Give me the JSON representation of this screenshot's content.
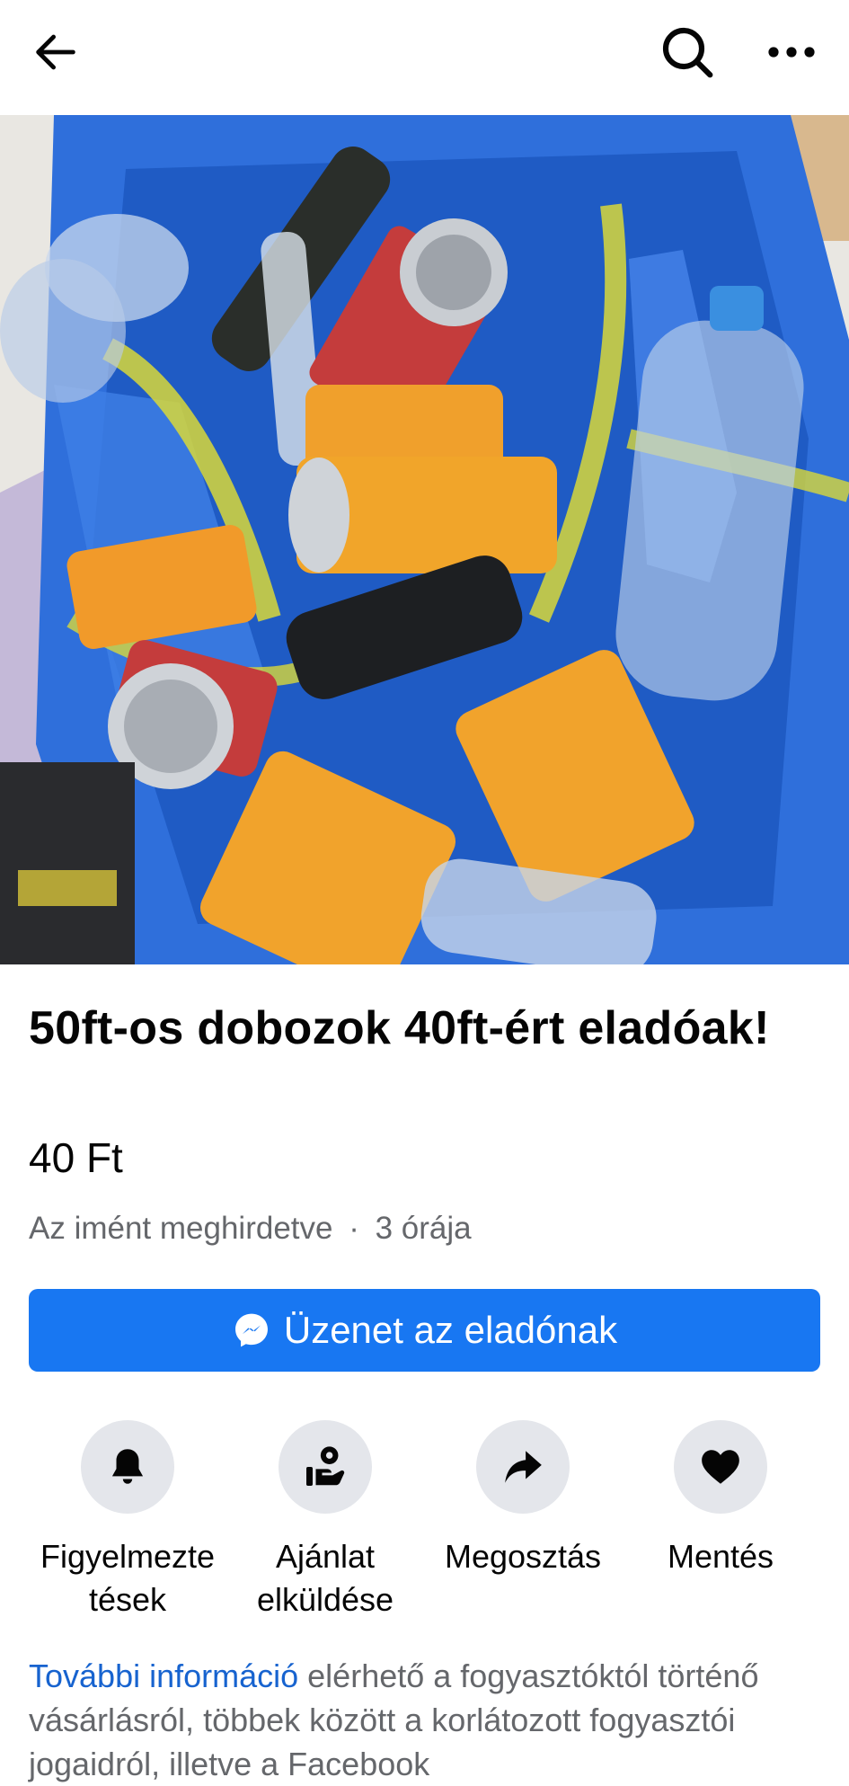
{
  "header": {
    "back_icon": "arrow-left-icon",
    "search_icon": "search-icon",
    "more_icon": "more-horizontal-icon"
  },
  "listing": {
    "title": "50ft-os dobozok 40ft-ért eladóak!",
    "price": "40 Ft",
    "posted": "Az imént meghirdetve",
    "separator": "·",
    "age": "3 órája"
  },
  "cta": {
    "icon": "messenger-icon",
    "label": "Üzenet az eladónak",
    "color": "#1877f2"
  },
  "actions": [
    {
      "icon": "bell-icon",
      "label_line1": "Figyelmezte",
      "label_line2": "tések"
    },
    {
      "icon": "offer-hand-icon",
      "label_line1": "Ajánlat",
      "label_line2": "elküldése"
    },
    {
      "icon": "share-icon",
      "label_line1": "Megosztás",
      "label_line2": ""
    },
    {
      "icon": "heart-icon",
      "label_line1": "Mentés",
      "label_line2": ""
    }
  ],
  "info": {
    "link": "További információ",
    "text": " elérhető a fogyasztóktól történő vásárlásról, többek között a korlátozott fogyasztói jogaidról, illetve a Facebook"
  }
}
